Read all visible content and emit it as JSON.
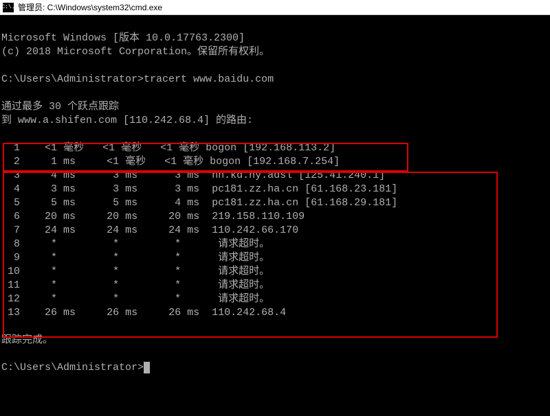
{
  "titlebar": {
    "icon_label": "C:\\.",
    "title": "管理员: C:\\Windows\\system32\\cmd.exe"
  },
  "term": {
    "header_line1": "Microsoft Windows [版本 10.0.17763.2300]",
    "header_line2": "(c) 2018 Microsoft Corporation。保留所有权利。",
    "prompt1_path": "C:\\Users\\Administrator>",
    "prompt1_cmd": "tracert www.baidu.com",
    "trace_info1": "通过最多 30 个跃点跟踪",
    "trace_info2": "到 www.a.shifen.com [110.242.68.4] 的路由:",
    "hops": [
      {
        "n": " 1",
        "t1": "  <1 毫秒",
        "t2": "  <1 毫秒",
        "t3": "  <1 毫秒",
        "host": " bogon [192.168.113.2]"
      },
      {
        "n": " 2",
        "t1": "   1 ms  ",
        "t2": "  <1 毫秒",
        "t3": "  <1 毫秒",
        "host": " bogon [192.168.7.254]"
      },
      {
        "n": " 3",
        "t1": "   4 ms  ",
        "t2": "   3 ms  ",
        "t3": "   3 ms ",
        "host": " hn.kd.ny.adsl [125.41.240.1]"
      },
      {
        "n": " 4",
        "t1": "   3 ms  ",
        "t2": "   3 ms  ",
        "t3": "   3 ms ",
        "host": " pc181.zz.ha.cn [61.168.23.181]"
      },
      {
        "n": " 5",
        "t1": "   5 ms  ",
        "t2": "   5 ms  ",
        "t3": "   4 ms ",
        "host": " pc181.zz.ha.cn [61.168.29.181]"
      },
      {
        "n": " 6",
        "t1": "  20 ms  ",
        "t2": "  20 ms  ",
        "t3": "  20 ms ",
        "host": " 219.158.110.109"
      },
      {
        "n": " 7",
        "t1": "  24 ms  ",
        "t2": "  24 ms  ",
        "t3": "  24 ms ",
        "host": " 110.242.66.170"
      },
      {
        "n": " 8",
        "t1": "   *     ",
        "t2": "   *     ",
        "t3": "   *    ",
        "host": "  请求超时。"
      },
      {
        "n": " 9",
        "t1": "   *     ",
        "t2": "   *     ",
        "t3": "   *    ",
        "host": "  请求超时。"
      },
      {
        "n": "10",
        "t1": "   *     ",
        "t2": "   *     ",
        "t3": "   *    ",
        "host": "  请求超时。"
      },
      {
        "n": "11",
        "t1": "   *     ",
        "t2": "   *     ",
        "t3": "   *    ",
        "host": "  请求超时。"
      },
      {
        "n": "12",
        "t1": "   *     ",
        "t2": "   *     ",
        "t3": "   *    ",
        "host": "  请求超时。"
      },
      {
        "n": "13",
        "t1": "  26 ms  ",
        "t2": "  26 ms  ",
        "t3": "  26 ms ",
        "host": " 110.242.68.4"
      }
    ],
    "complete": "跟踪完成。",
    "prompt2_path": "C:\\Users\\Administrator>"
  }
}
